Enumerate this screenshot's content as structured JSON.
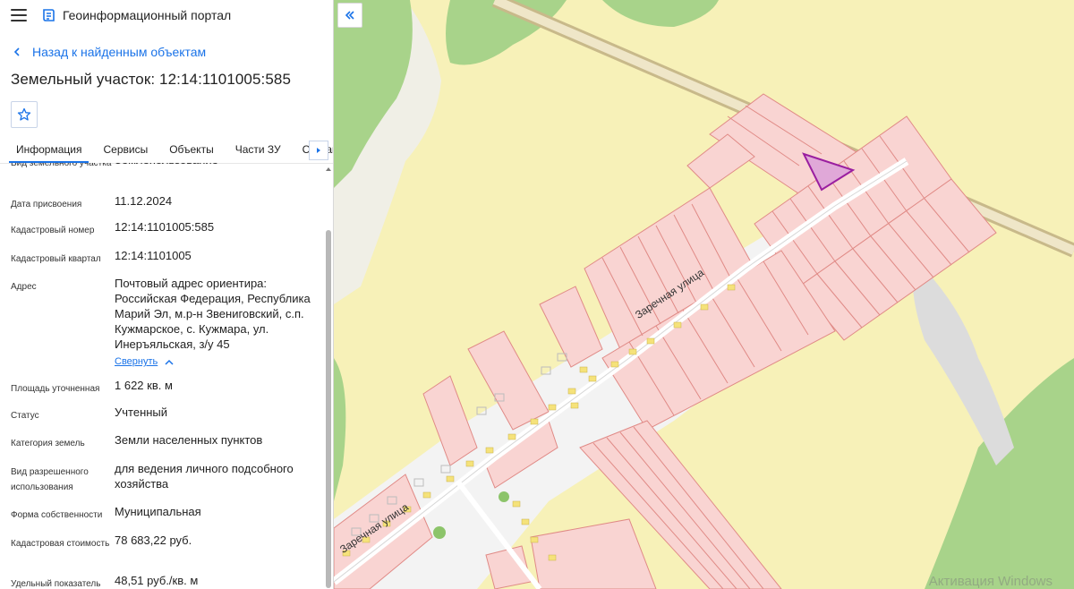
{
  "header": {
    "title": "Геоинформационный портал"
  },
  "back": {
    "label": "Назад к найденным объектам"
  },
  "page_title": "Земельный участок: 12:14:1101005:585",
  "tabs": [
    "Информация",
    "Сервисы",
    "Объекты",
    "Части ЗУ",
    "Состав"
  ],
  "info": {
    "land_type": {
      "label": "Вид земельного участка",
      "value": "Землепользование"
    },
    "assign_date": {
      "label": "Дата присвоения",
      "value": "11.12.2024"
    },
    "cad_number": {
      "label": "Кадастровый номер",
      "value": "12:14:1101005:585"
    },
    "cad_block": {
      "label": "Кадастровый квартал",
      "value": "12:14:1101005"
    },
    "address": {
      "label": "Адрес",
      "value": "Почтовый адрес ориентира: Российская Федерация, Республика Марий Эл, м.р-н Звениговский, с.п. Кужмарское, с. Кужмара, ул. Инеръяльская, з/у 45",
      "collapse": "Свернуть"
    },
    "area": {
      "label": "Площадь уточненная",
      "value": "1 622 кв. м"
    },
    "status": {
      "label": "Статус",
      "value": "Учтенный"
    },
    "category": {
      "label": "Категория земель",
      "value": "Земли населенных пунктов"
    },
    "permitted_use": {
      "label": "Вид разрешенного использования",
      "value": "для ведения личного подсобного хозяйства"
    },
    "ownership": {
      "label": "Форма собственности",
      "value": "Муниципальная"
    },
    "cad_value": {
      "label": "Кадастровая стоимость",
      "value": "78 683,22 руб."
    },
    "specific_value": {
      "label": "Удельный показатель",
      "value": "48,51 руб./кв. м"
    }
  },
  "map": {
    "street_label": "Заречная улица",
    "watermark": "Активация Windows",
    "colors": {
      "field": "#f7f1b8",
      "forest": "#a8d38a",
      "parcel_fill": "#f9d4d2",
      "parcel_stroke": "#e08a86",
      "selected_fill": "#e0a8d8",
      "selected_stroke": "#9a1ea0",
      "road": "#e4dcc0",
      "building": "#f5e27a"
    }
  }
}
